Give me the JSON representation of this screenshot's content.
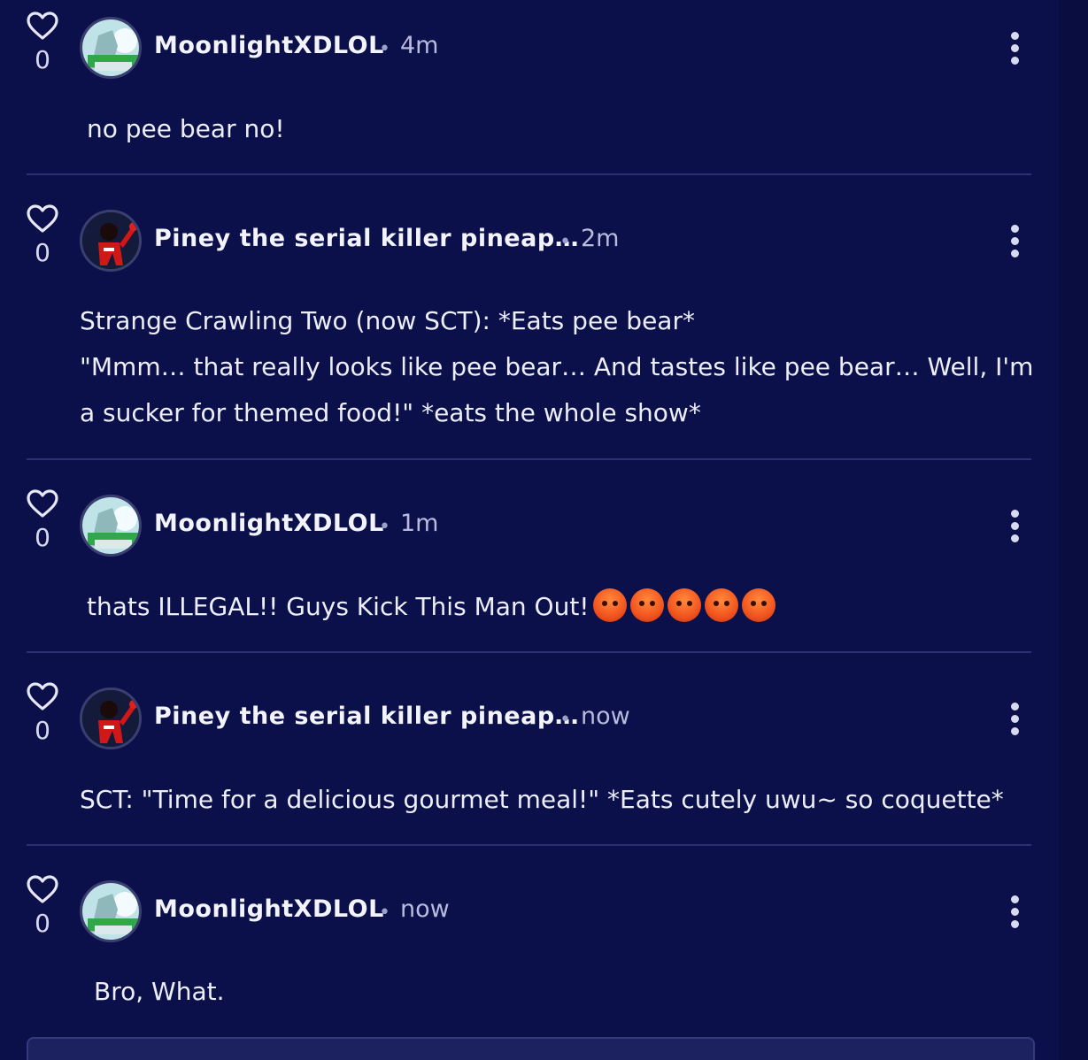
{
  "colors": {
    "background": "#0b0f4a",
    "divider": "#2c3170",
    "text": "#eceef9",
    "muted": "#b8bcdc"
  },
  "comments": [
    {
      "username": "MoonlightXDLOL",
      "time": "4m",
      "likes": "0",
      "avatar": "moonlight-avatar",
      "lines": [
        "no pee bear no!"
      ]
    },
    {
      "username": "Piney the serial killer pineap…",
      "time": "2m",
      "likes": "0",
      "avatar": "piney-avatar",
      "lines": [
        "Strange Crawling Two (now SCT): *Eats pee bear*",
        "\"Mmm… that really looks like pee bear… And tastes like pee bear… Well, I'm",
        "a sucker for themed food!\" *eats the whole show*"
      ]
    },
    {
      "username": "MoonlightXDLOL",
      "time": "1m",
      "likes": "0",
      "avatar": "moonlight-avatar",
      "lines": [
        "thats ILLEGAL!! Guys Kick This Man Out!"
      ],
      "emoji_count": 5,
      "emoji": "angry-face-icon"
    },
    {
      "username": "Piney the serial killer pineap…",
      "time": "now",
      "likes": "0",
      "avatar": "piney-avatar",
      "lines": [
        "SCT: \"Time for a delicious gourmet meal!\" *Eats cutely uwu~ so coquette*"
      ]
    },
    {
      "username": "MoonlightXDLOL",
      "time": "now",
      "likes": "0",
      "avatar": "moonlight-avatar",
      "lines": [
        "Bro, What."
      ]
    }
  ],
  "separator_dot": "•"
}
